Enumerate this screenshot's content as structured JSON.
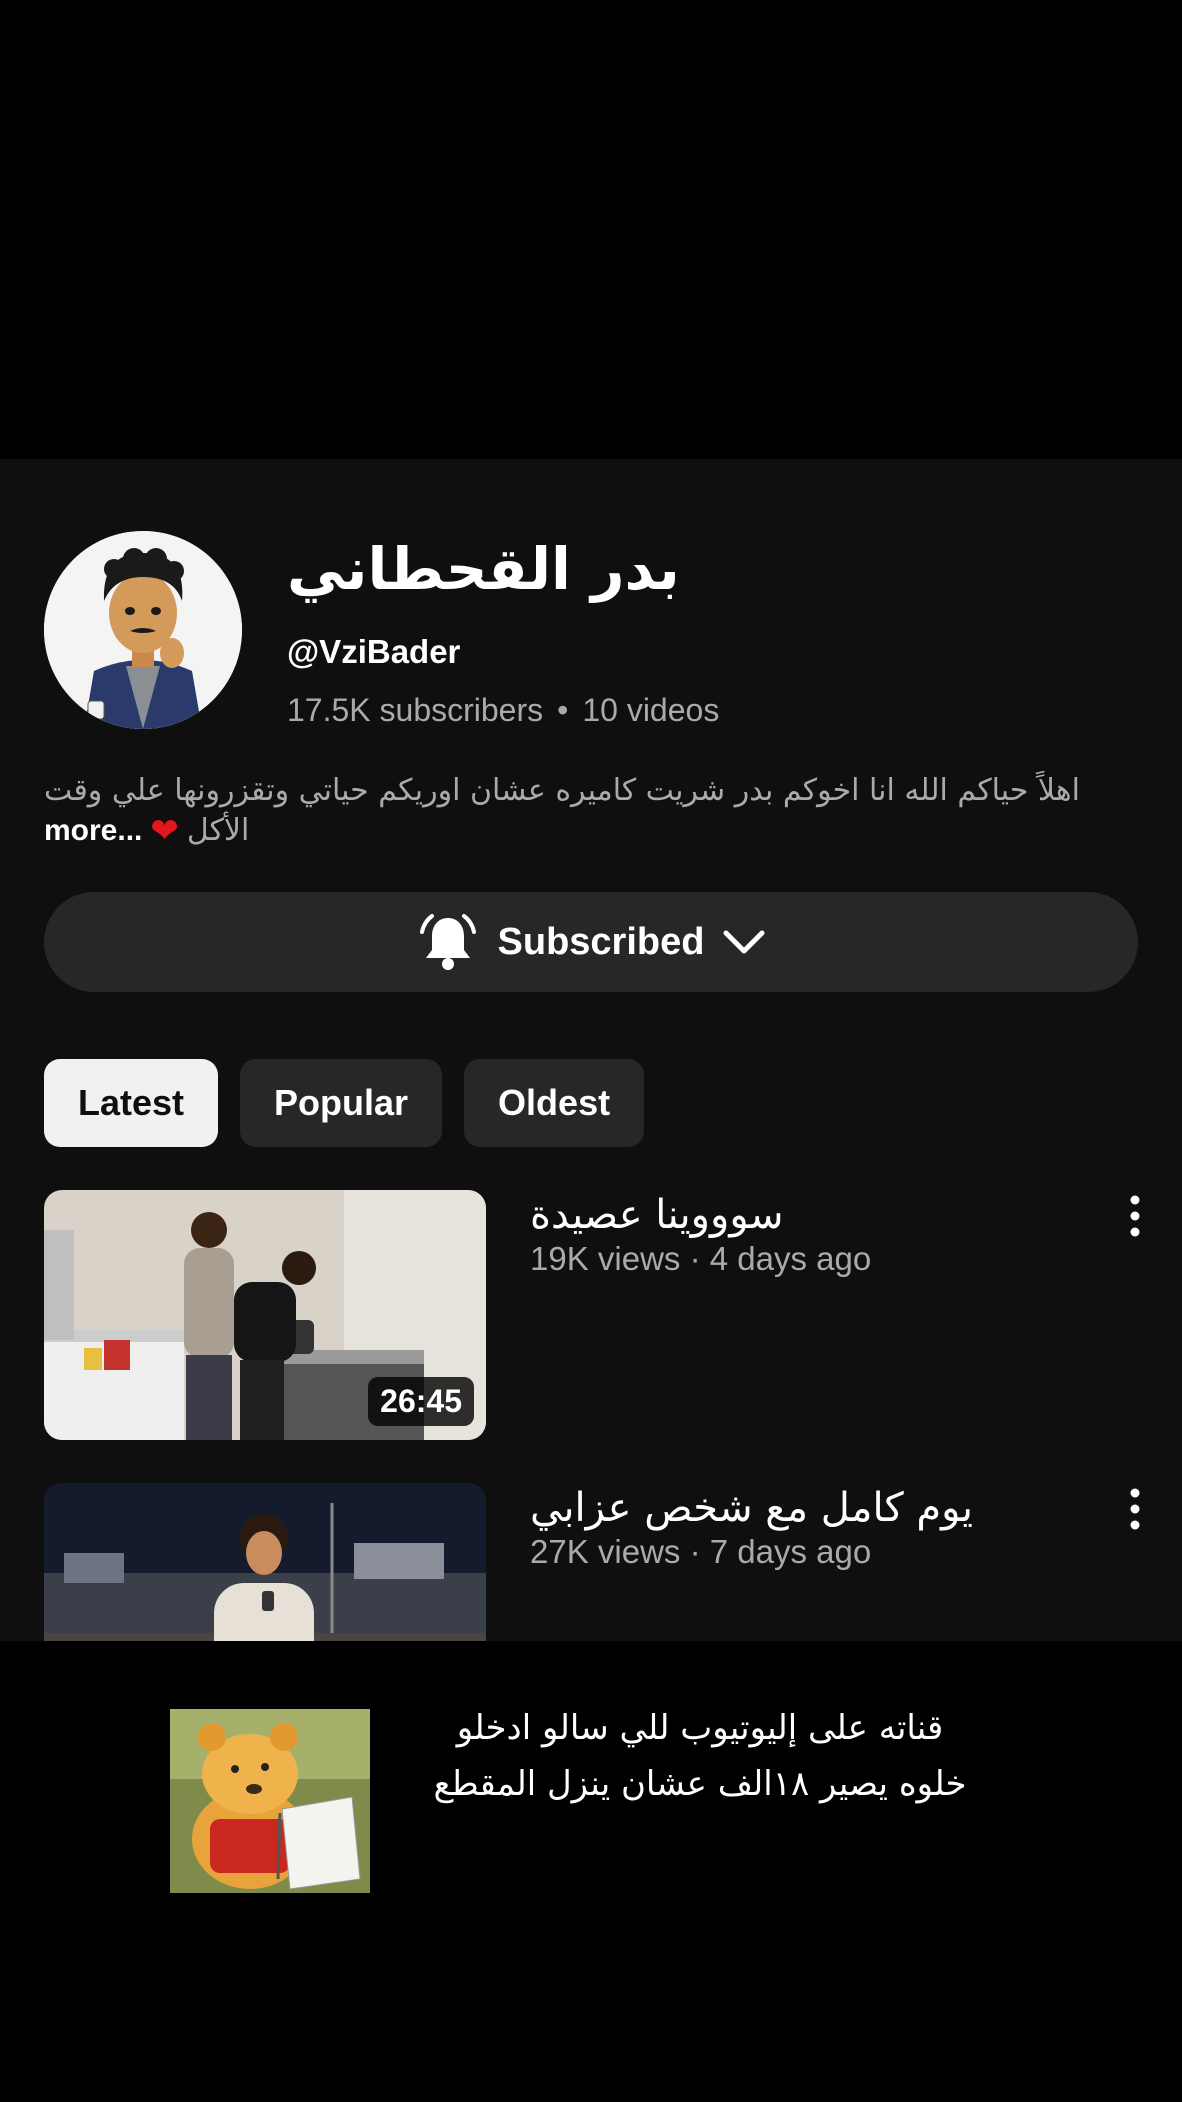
{
  "channel": {
    "name": "بدر القحطاني",
    "handle": "@VziBader",
    "subscribers": "17.5K subscribers",
    "videos_count": "10 videos",
    "separator": "•",
    "description": "اهلاً حياكم الله انا اخوكم بدر شريت كاميره عشان اوريكم حياتي وتقزرونها علي وقت",
    "description_line2": "الأكل",
    "more_label": "more...",
    "heart": "❤",
    "avatar_icon": "cartoon-avatar-icon"
  },
  "subscribe_button": {
    "label": "Subscribed",
    "icon": "bell-icon",
    "chevron": "chevron-down-icon"
  },
  "filters": [
    {
      "label": "Latest",
      "active": true
    },
    {
      "label": "Popular",
      "active": false
    },
    {
      "label": "Oldest",
      "active": false
    }
  ],
  "videos": [
    {
      "title": "سوووينا عصيدة",
      "meta": "19K views · 4 days ago",
      "duration": "26:45"
    },
    {
      "title": "يوم كامل مع شخص عزابي",
      "meta": "27K views · 7 days ago",
      "duration": ""
    }
  ],
  "overlay_caption": {
    "line1": "قناته على إليوتيوب للي سالو ادخلو",
    "line2": "خلوه يصير ١٨الف عشان ينزل المقطع",
    "sticker": "winnie-the-pooh-thinking"
  },
  "colors": {
    "panel_bg": "#0f0f0f",
    "chip_bg": "#272727",
    "chip_active_bg": "#f1f1f1",
    "secondary_text": "#aaaaaa"
  }
}
